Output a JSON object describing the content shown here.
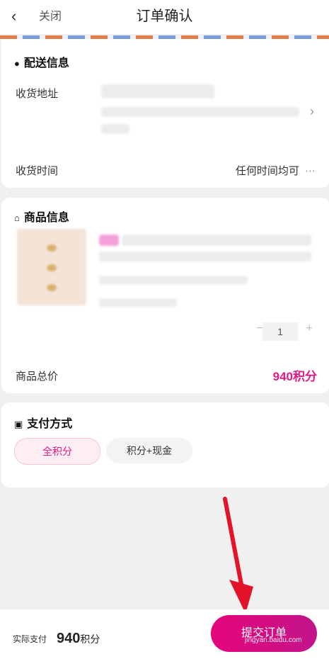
{
  "header": {
    "back_icon": "chevron-left-icon",
    "close_label": "关闭",
    "title": "订单确认"
  },
  "delivery": {
    "section_title": "配送信息",
    "address_label": "收货地址",
    "time_label": "收货时间",
    "time_value": "任何时间均可"
  },
  "goods": {
    "section_title": "商品信息",
    "quantity": "1",
    "total_label": "商品总价",
    "total_value": "940积分"
  },
  "payment": {
    "section_title": "支付方式",
    "options": [
      {
        "label": "全积分",
        "selected": true
      },
      {
        "label": "积分+现金",
        "selected": false
      }
    ]
  },
  "footer": {
    "actual_label": "实际支付",
    "actual_value": "940",
    "actual_unit": "积分",
    "submit_label": "提交订单"
  },
  "colors": {
    "accent": "#e01a86",
    "stripe_orange": "#e27d4c",
    "stripe_blue": "#7b9de0",
    "arrow": "#e3132a"
  },
  "watermark": "jingyan.baidu.com"
}
